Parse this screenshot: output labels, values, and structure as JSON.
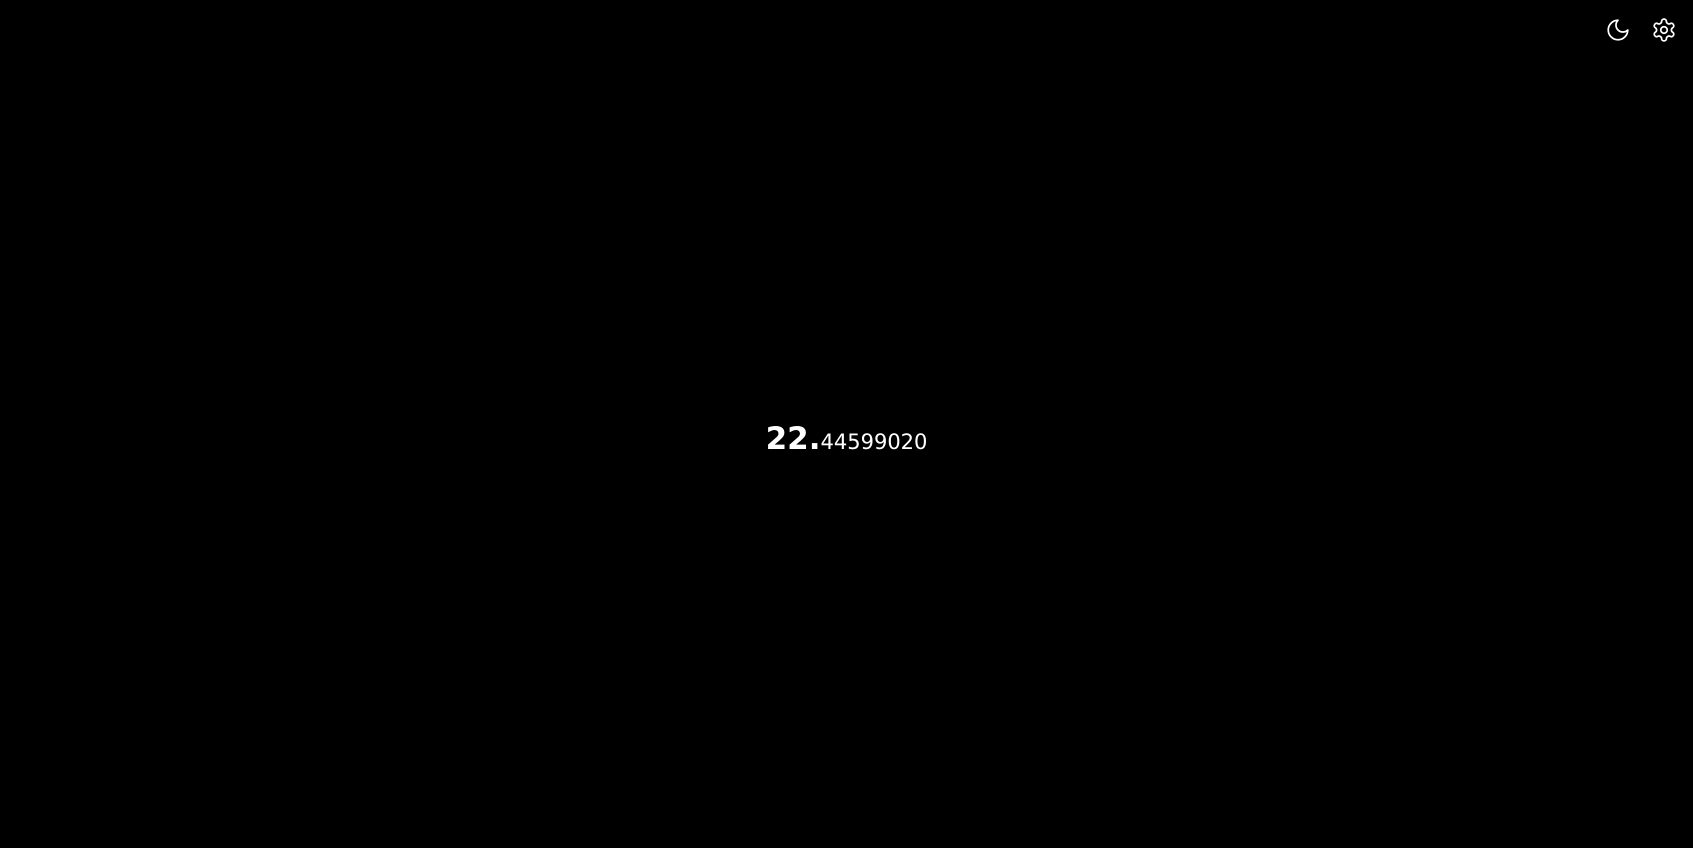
{
  "toolbar": {
    "theme_toggle_icon": "moon-icon",
    "settings_icon": "gear-icon"
  },
  "display": {
    "integer_part": "22.",
    "fraction_part": "44599020"
  },
  "colors": {
    "background": "#000000",
    "foreground": "#ffffff"
  }
}
